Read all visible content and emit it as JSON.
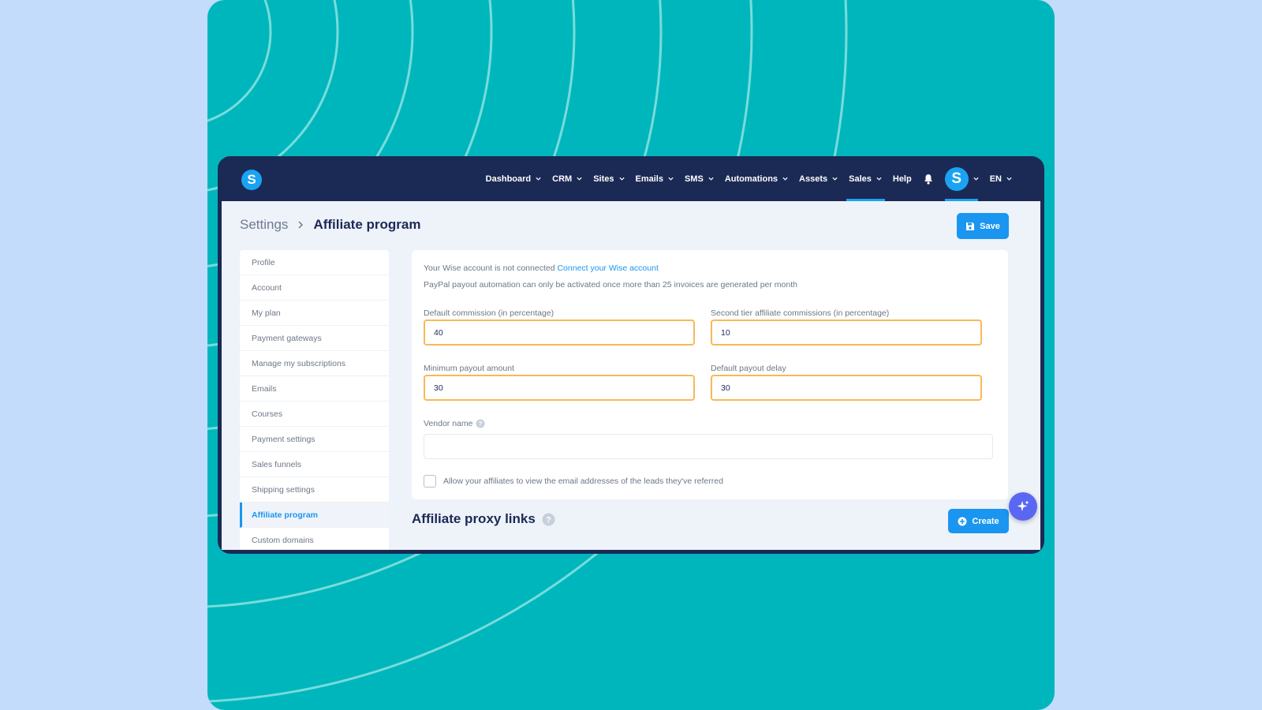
{
  "app": {
    "logo_letter": "S",
    "accent_color": "#1a96f0",
    "nav_bg": "#1b2a55"
  },
  "nav": {
    "items": [
      {
        "label": "Dashboard",
        "has_dropdown": true
      },
      {
        "label": "CRM",
        "has_dropdown": true
      },
      {
        "label": "Sites",
        "has_dropdown": true
      },
      {
        "label": "Emails",
        "has_dropdown": true
      },
      {
        "label": "SMS",
        "has_dropdown": true
      },
      {
        "label": "Automations",
        "has_dropdown": true
      },
      {
        "label": "Assets",
        "has_dropdown": true
      },
      {
        "label": "Sales",
        "has_dropdown": true,
        "active": true
      },
      {
        "label": "Help",
        "has_dropdown": false
      }
    ],
    "bell_icon": "bell-icon",
    "avatar_letter": "S",
    "language": "EN"
  },
  "breadcrumb": {
    "parent": "Settings",
    "current": "Affiliate program"
  },
  "toolbar": {
    "save_label": "Save",
    "save_icon": "floppy-disk-icon"
  },
  "sidebar": {
    "items": [
      {
        "label": "Profile"
      },
      {
        "label": "Account"
      },
      {
        "label": "My plan"
      },
      {
        "label": "Payment gateways"
      },
      {
        "label": "Manage my subscriptions"
      },
      {
        "label": "Emails"
      },
      {
        "label": "Courses"
      },
      {
        "label": "Payment settings"
      },
      {
        "label": "Sales funnels"
      },
      {
        "label": "Shipping settings"
      },
      {
        "label": "Affiliate program",
        "active": true
      },
      {
        "label": "Custom domains"
      }
    ]
  },
  "form": {
    "wise_notice": "Your Wise account is not connected",
    "wise_link": "Connect your Wise account",
    "paypal_notice": "PayPal payout automation can only be activated once more than 25 invoices are generated per month",
    "default_commission": {
      "label": "Default commission (in percentage)",
      "value": "40"
    },
    "second_tier": {
      "label": "Second tier affiliate commissions (in percentage)",
      "value": "10"
    },
    "min_payout": {
      "label": "Minimum payout amount",
      "value": "30"
    },
    "payout_delay": {
      "label": "Default payout delay",
      "value": "30"
    },
    "vendor_name": {
      "label": "Vendor name",
      "value": ""
    },
    "allow_emails": {
      "label": "Allow your affiliates to view the email addresses of the leads they've referred",
      "checked": false
    }
  },
  "proxy": {
    "title": "Affiliate proxy links",
    "create_label": "Create",
    "create_icon": "plus-circle-icon"
  },
  "fab": {
    "icon": "sparkle-icon"
  },
  "colors": {
    "page_bg": "#c3dcfb",
    "teal": "#00b6bd",
    "highlight_border": "#f8b955"
  }
}
